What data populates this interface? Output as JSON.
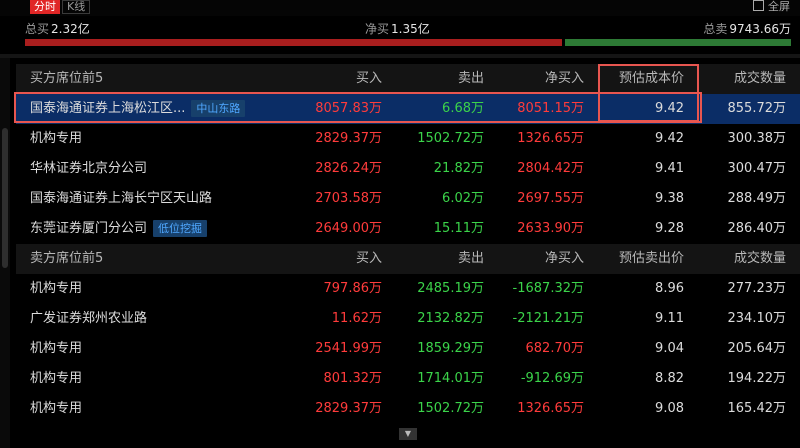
{
  "tabs": {
    "fenshi": "分时",
    "kline": "K线"
  },
  "toolbar": {
    "fullscreen": "全屏"
  },
  "summary": {
    "total_buy_label": "总买",
    "total_buy_value": "2.32亿",
    "net_buy_label": "净买",
    "net_buy_value": "1.35亿",
    "total_sell_label": "总卖",
    "total_sell_value": "9743.66万",
    "buy_ratio": 0.704
  },
  "buy_table": {
    "headers": [
      "买方席位前5",
      "买入",
      "卖出",
      "净买入",
      "预估成本价",
      "成交数量"
    ],
    "rows": [
      {
        "name": "国泰海通证券上海松江区...",
        "tag": "中山东路",
        "buy": "8057.83万",
        "sell": "6.68万",
        "net": "8051.15万",
        "price": "9.42",
        "volume": "855.72万"
      },
      {
        "name": "机构专用",
        "tag": "",
        "buy": "2829.37万",
        "sell": "1502.72万",
        "net": "1326.65万",
        "price": "9.42",
        "volume": "300.38万"
      },
      {
        "name": "华林证券北京分公司",
        "tag": "",
        "buy": "2826.24万",
        "sell": "21.82万",
        "net": "2804.42万",
        "price": "9.41",
        "volume": "300.47万"
      },
      {
        "name": "国泰海通证券上海长宁区天山路",
        "tag": "",
        "buy": "2703.58万",
        "sell": "6.02万",
        "net": "2697.55万",
        "price": "9.38",
        "volume": "288.49万"
      },
      {
        "name": "东莞证券厦门分公司",
        "tag": "低位挖掘",
        "buy": "2649.00万",
        "sell": "15.11万",
        "net": "2633.90万",
        "price": "9.28",
        "volume": "286.40万"
      }
    ]
  },
  "sell_table": {
    "headers": [
      "卖方席位前5",
      "买入",
      "卖出",
      "净买入",
      "预估卖出价",
      "成交数量"
    ],
    "rows": [
      {
        "name": "机构专用",
        "buy": "797.86万",
        "sell": "2485.19万",
        "net": "-1687.32万",
        "price": "8.96",
        "volume": "277.23万"
      },
      {
        "name": "广发证券郑州农业路",
        "buy": "11.62万",
        "sell": "2132.82万",
        "net": "-2121.21万",
        "price": "9.11",
        "volume": "234.10万"
      },
      {
        "name": "机构专用",
        "buy": "2541.99万",
        "sell": "1859.29万",
        "net": "682.70万",
        "price": "9.04",
        "volume": "205.64万"
      },
      {
        "name": "机构专用",
        "buy": "801.32万",
        "sell": "1714.01万",
        "net": "-912.69万",
        "price": "8.82",
        "volume": "194.22万"
      },
      {
        "name": "机构专用",
        "buy": "2829.37万",
        "sell": "1502.72万",
        "net": "1326.65万",
        "price": "9.08",
        "volume": "165.42万"
      }
    ]
  },
  "colors": {
    "up": "#ff3b3b",
    "down": "#3bd34a",
    "selected_row": "#0b2d66",
    "highlight_box": "#e85650"
  },
  "icons": {
    "fullscreen": "fullscreen-icon",
    "expand": "chevron-down-icon"
  }
}
